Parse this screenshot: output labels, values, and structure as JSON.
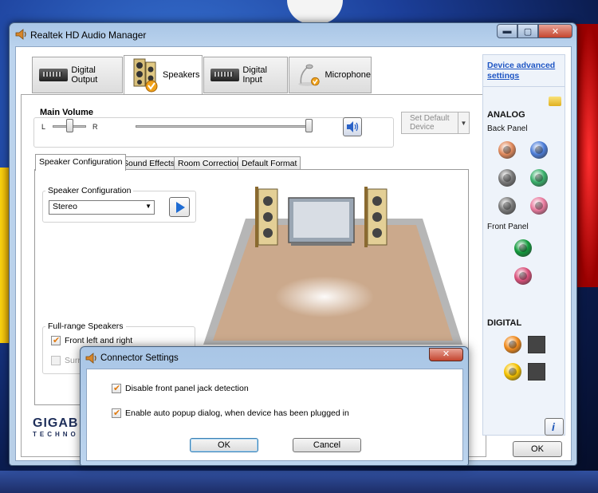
{
  "window": {
    "title": "Realtek HD Audio Manager",
    "caption_min": "▬",
    "caption_max": "▢",
    "caption_close": "✕"
  },
  "device_tabs": [
    {
      "label": "Digital Output",
      "active": false
    },
    {
      "label": "Speakers",
      "active": true
    },
    {
      "label": "Digital Input",
      "active": false
    },
    {
      "label": "Microphone",
      "active": false
    }
  ],
  "main_volume": {
    "title": "Main Volume",
    "left_label": "L",
    "right_label": "R",
    "balance_level": 0.5,
    "volume_level": 1.0
  },
  "set_default": {
    "label_line1": "Set Default",
    "label_line2": "Device",
    "arrow": "▼"
  },
  "sub_tabs": [
    {
      "label": "Speaker Configuration",
      "active": true
    },
    {
      "label": "Sound Effects",
      "active": false
    },
    {
      "label": "Room Correction",
      "active": false
    },
    {
      "label": "Default Format",
      "active": false
    }
  ],
  "speaker_config": {
    "group_title": "Speaker Configuration",
    "selected": "Stereo",
    "arrow": "▼"
  },
  "full_range": {
    "group_title": "Full-range Speakers",
    "front_label": "Front left and right",
    "front_checked": true,
    "surround_label": "Surr",
    "surround_checked": false
  },
  "logo": {
    "brand": "GIGAB",
    "tagline": "TECHNO"
  },
  "right_pane": {
    "advanced_link_line1": "Device advanced",
    "advanced_link_line2": "settings",
    "analog_heading": "ANALOG",
    "back_panel_label": "Back Panel",
    "front_panel_label": "Front Panel",
    "digital_heading": "DIGITAL",
    "jack_colors": {
      "orange": "#e0895c",
      "blue": "#4d7ed9",
      "gray": "#7a7a7a",
      "green": "#39b06b",
      "pink": "#e97a9e",
      "front_green": "#129a3c",
      "front_pink": "#d9507a",
      "digital_orange": "#f08a1d",
      "digital_yellow": "#f5c200"
    }
  },
  "ok_main": "OK",
  "dialog": {
    "title": "Connector Settings",
    "close": "✕",
    "opt1_label": "Disable front panel jack detection",
    "opt1_checked": true,
    "opt2_label": "Enable auto popup dialog, when device has been plugged in",
    "opt2_checked": true,
    "ok_label": "OK",
    "cancel_label": "Cancel"
  }
}
